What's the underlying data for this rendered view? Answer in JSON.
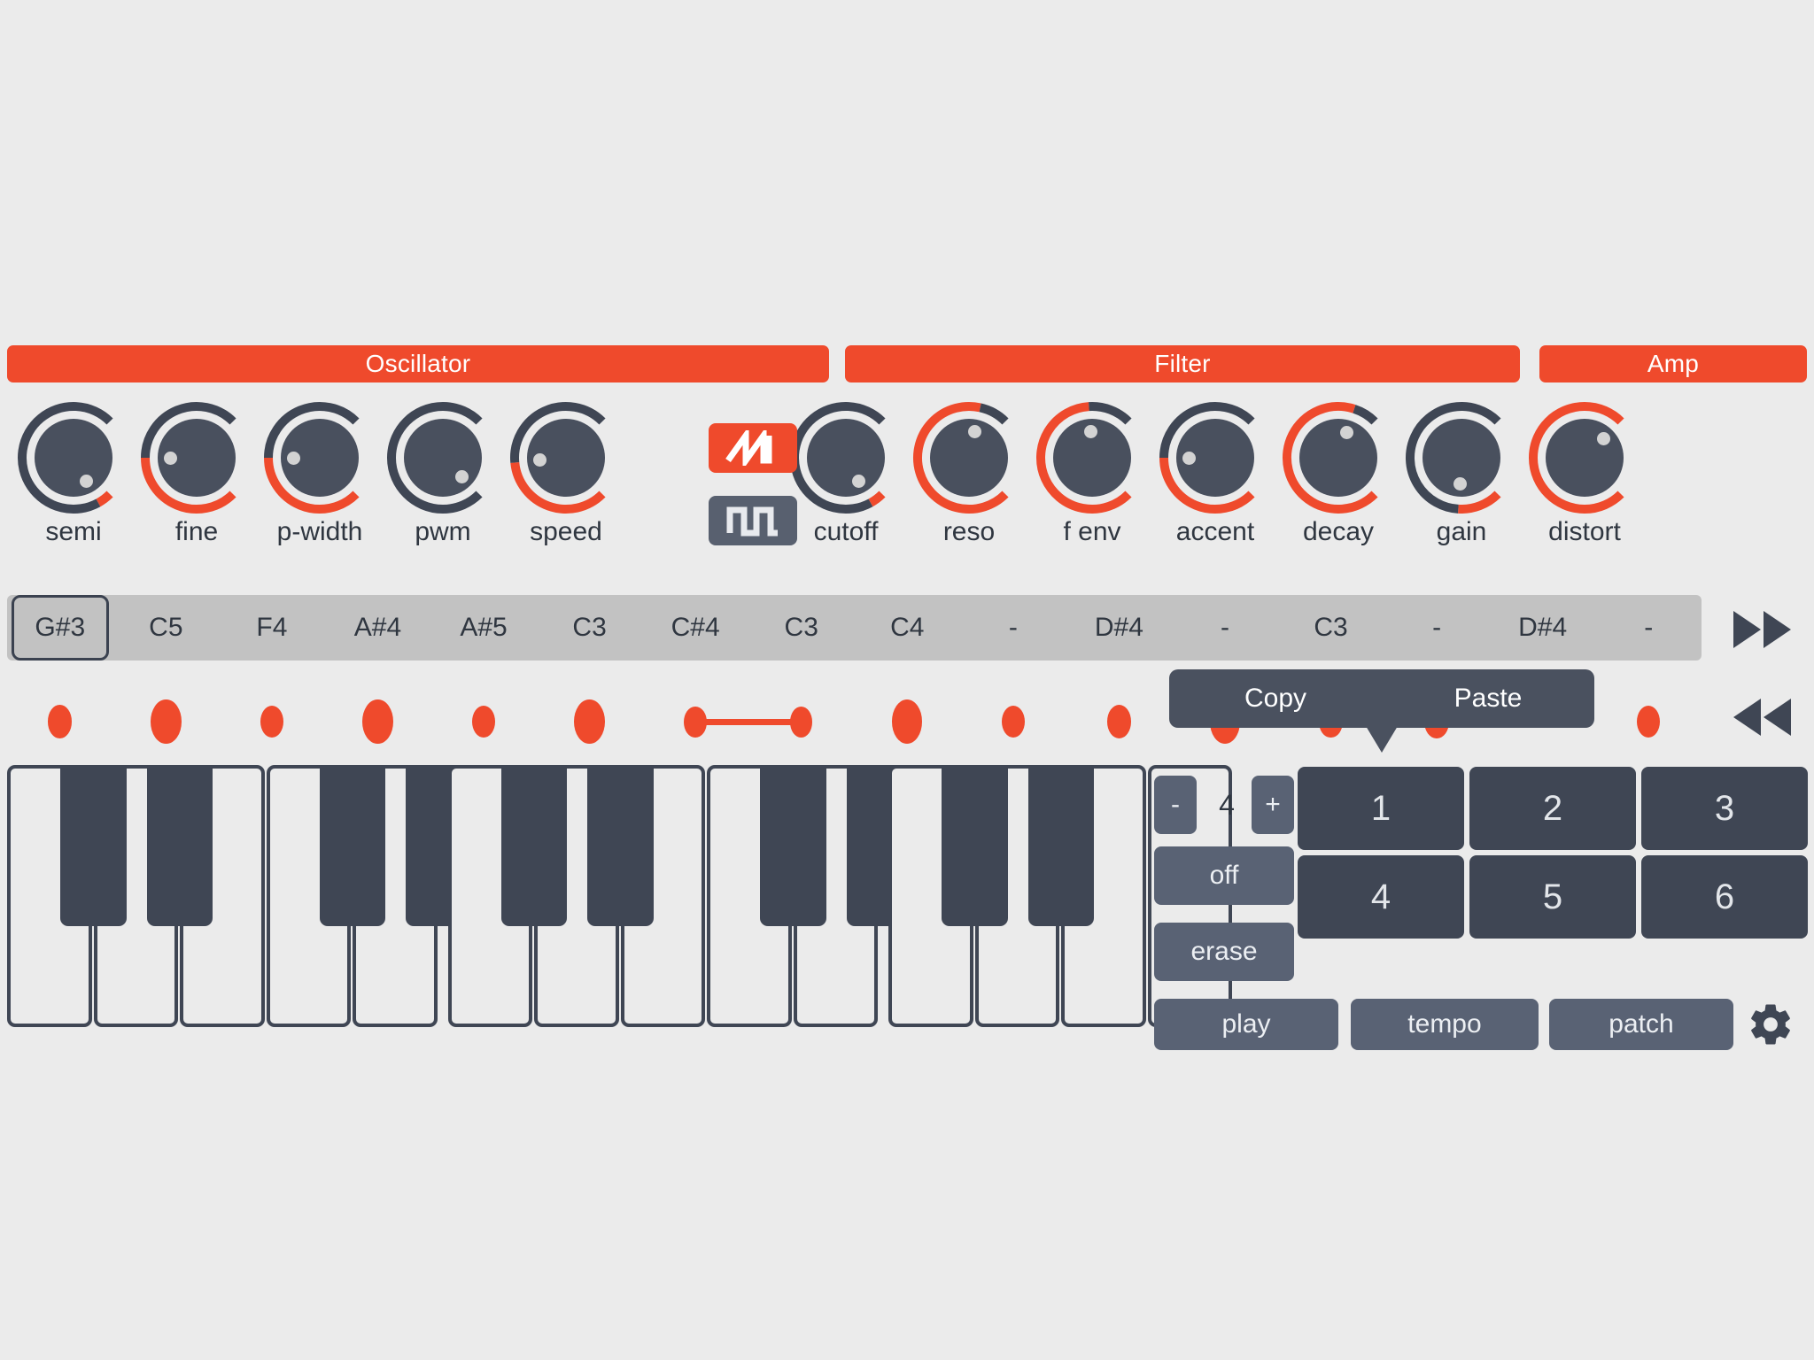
{
  "theme": {
    "background": "#ebebeb",
    "accent": "#ef4a2c",
    "dark": "#3f4654",
    "button": "#596274",
    "pad": "#3f4654",
    "strip": "#c2c2c2"
  },
  "sections": [
    {
      "name": "oscillator",
      "label": "Oscillator"
    },
    {
      "name": "filter",
      "label": "Filter"
    },
    {
      "name": "amp",
      "label": "Amp"
    }
  ],
  "knobs": [
    {
      "name": "semi",
      "label": "semi",
      "value": 0.06
    },
    {
      "name": "fine",
      "label": "fine",
      "value": 0.5
    },
    {
      "name": "p-width",
      "label": "p-width",
      "value": 0.5
    },
    {
      "name": "pwm",
      "label": "pwm",
      "value": 0.0
    },
    {
      "name": "speed",
      "label": "speed",
      "value": 0.48
    },
    {
      "name": "cutoff",
      "label": "cutoff",
      "value": 0.06
    },
    {
      "name": "reso",
      "label": "reso",
      "value": 0.88
    },
    {
      "name": "f-env",
      "label": "f env",
      "value": 0.82
    },
    {
      "name": "accent",
      "label": "accent",
      "value": 0.5
    },
    {
      "name": "decay",
      "label": "decay",
      "value": 0.9
    },
    {
      "name": "gain",
      "label": "gain",
      "value": 0.18
    },
    {
      "name": "distort",
      "label": "distort",
      "value": 1.0
    }
  ],
  "waveforms": [
    {
      "name": "sawtooth",
      "icon": "sawtooth-wave-icon",
      "selected": true
    },
    {
      "name": "pulse",
      "icon": "pulse-wave-icon",
      "selected": false
    }
  ],
  "sequencer": {
    "selected_step": 0,
    "steps": [
      {
        "note": "G#3",
        "velocity": 0.38,
        "tie": false
      },
      {
        "note": "C5",
        "velocity": 0.8,
        "tie": false
      },
      {
        "note": "F4",
        "velocity": 0.34,
        "tie": false
      },
      {
        "note": "A#4",
        "velocity": 0.8,
        "tie": false
      },
      {
        "note": "A#5",
        "velocity": 0.36,
        "tie": false
      },
      {
        "note": "C3",
        "velocity": 0.8,
        "tie": false
      },
      {
        "note": "C#4",
        "velocity": 0.3,
        "tie": true
      },
      {
        "note": "C3",
        "velocity": 0.3,
        "tie": false
      },
      {
        "note": "C4",
        "velocity": 0.8,
        "tie": false
      },
      {
        "note": "-",
        "velocity": 0.34,
        "tie": false
      },
      {
        "note": "D#4",
        "velocity": 0.42,
        "tie": false
      },
      {
        "note": "-",
        "velocity": 0.8,
        "tie": false
      },
      {
        "note": "C3",
        "velocity": 0.34,
        "tie": false
      },
      {
        "note": "-",
        "velocity": 0.4,
        "tie": false
      },
      {
        "note": "D#4",
        "velocity": 0.0,
        "tie": false
      },
      {
        "note": "-",
        "velocity": 0.34,
        "tie": false
      }
    ],
    "transport": [
      {
        "name": "fast-forward",
        "icon": "fast-forward-icon"
      },
      {
        "name": "rewind",
        "icon": "rewind-icon"
      }
    ]
  },
  "tooltip": {
    "copy_label": "Copy",
    "paste_label": "Paste"
  },
  "keyboard": {
    "octaves": [
      {
        "white": 5,
        "black": [
          0,
          1,
          3,
          4
        ]
      },
      {
        "white": 5,
        "black": [
          0,
          1,
          3,
          4
        ]
      },
      {
        "white": 4,
        "black": [
          0,
          1
        ]
      }
    ]
  },
  "panel": {
    "steps_minus": "-",
    "steps_value": "4",
    "steps_plus": "+",
    "off_label": "off",
    "erase_label": "erase",
    "play_label": "play",
    "tempo_label": "tempo",
    "patch_label": "patch",
    "settings_icon": "gear-icon",
    "patterns": [
      "1",
      "2",
      "3",
      "4",
      "5",
      "6"
    ]
  }
}
